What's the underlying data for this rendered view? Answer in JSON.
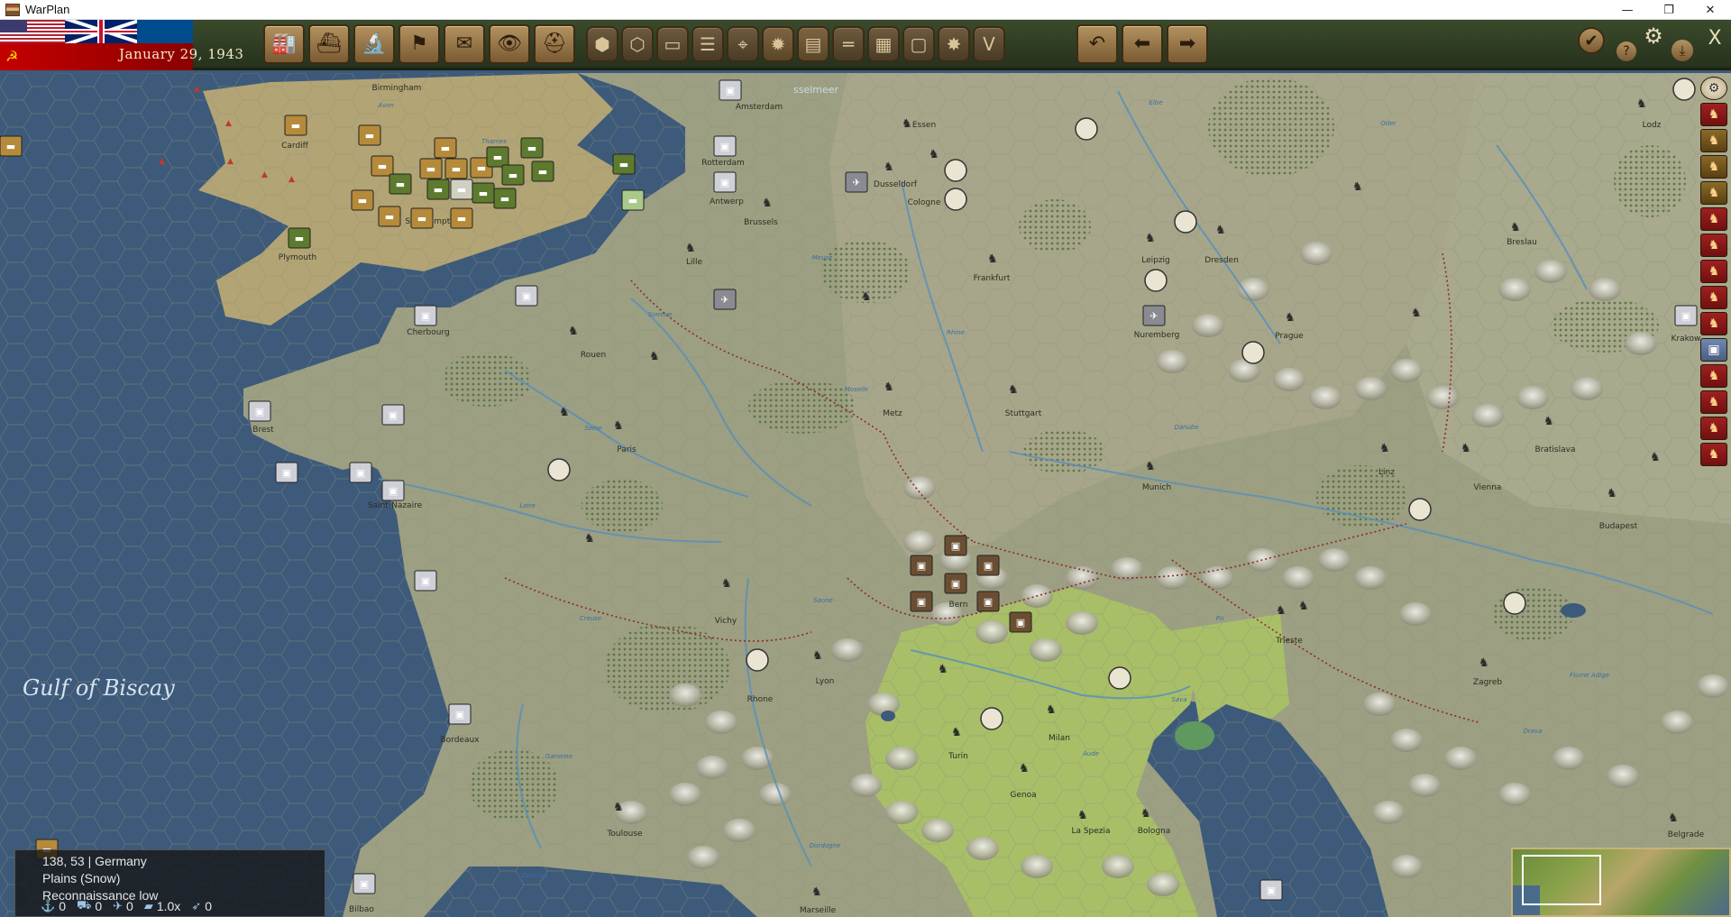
{
  "window": {
    "title": "WarPlan",
    "minimize": "—",
    "restore": "❐",
    "close": "✕"
  },
  "header": {
    "date": "January 29, 1943"
  },
  "toolbar": {
    "left_buttons": [
      {
        "name": "production-button",
        "icon": "factory-icon",
        "glyph": "🏭"
      },
      {
        "name": "naval-button",
        "icon": "ship-icon",
        "glyph": "⛴"
      },
      {
        "name": "research-button",
        "icon": "microscope-icon",
        "glyph": "🔬"
      },
      {
        "name": "diplomacy-button",
        "icon": "flag-icon",
        "glyph": "⚑"
      },
      {
        "name": "reports-button",
        "icon": "report-icon",
        "glyph": "✉"
      },
      {
        "name": "recon-button",
        "icon": "binoculars-icon",
        "glyph": "👁"
      },
      {
        "name": "units-button",
        "icon": "helmet-icon",
        "glyph": "⛑"
      }
    ],
    "map_filter_buttons": [
      {
        "name": "hex-mode-button",
        "icon": "hexagon-icon",
        "glyph": "⬢"
      },
      {
        "name": "hex-grid-button",
        "icon": "hex-grid-icon",
        "glyph": "⬡"
      },
      {
        "name": "supply-view-button",
        "icon": "supply-icon",
        "glyph": "▭"
      },
      {
        "name": "resources-view-button",
        "icon": "stack-icon",
        "glyph": "☰"
      },
      {
        "name": "target-view-button",
        "icon": "crosshair-icon",
        "glyph": "⌖"
      },
      {
        "name": "explosion-view-button",
        "icon": "burst-icon",
        "glyph": "✹"
      },
      {
        "name": "terrain-view-button",
        "icon": "terrain-icon",
        "glyph": "▤"
      },
      {
        "name": "rail-view-button",
        "icon": "rail-icon",
        "glyph": "═"
      },
      {
        "name": "grid-view-button",
        "icon": "grid-icon",
        "glyph": "▦"
      },
      {
        "name": "border-view-button",
        "icon": "frame-icon",
        "glyph": "▢"
      },
      {
        "name": "combat-view-button",
        "icon": "explosion-icon",
        "glyph": "✸"
      },
      {
        "name": "victory-view-button",
        "icon": "v-icon",
        "glyph": "V"
      }
    ],
    "nav_buttons": [
      {
        "name": "undo-button",
        "icon": "undo-icon",
        "glyph": "↶"
      },
      {
        "name": "previous-unit-button",
        "icon": "arrow-left-icon",
        "glyph": "⬅"
      },
      {
        "name": "next-unit-button",
        "icon": "arrow-right-icon",
        "glyph": "➡"
      }
    ],
    "right_buttons": [
      {
        "name": "end-turn-button",
        "icon": "checkmark-icon",
        "glyph": "✔"
      },
      {
        "name": "help-button",
        "icon": "question-icon",
        "glyph": "?"
      },
      {
        "name": "settings-button",
        "icon": "gears-icon",
        "glyph": "⚙"
      },
      {
        "name": "save-button",
        "icon": "download-icon",
        "glyph": "⤓"
      },
      {
        "name": "exit-button",
        "icon": "close-x-icon",
        "glyph": "X"
      }
    ]
  },
  "map": {
    "sea_labels": [
      {
        "name": "gulf-of-biscay",
        "text": "Gulf of Biscay"
      },
      {
        "name": "ijsselmeer",
        "text": "sselmeer"
      }
    ],
    "cities": [
      "Birmingham",
      "Cardiff",
      "Southampton",
      "Plymouth",
      "Amsterdam",
      "Rotterdam",
      "Antwerp",
      "Brussels",
      "Lille",
      "Essen",
      "Dusseldorf",
      "Cologne",
      "Frankfurt",
      "Leipzig",
      "Dresden",
      "Breslau",
      "Lodz",
      "Krakow",
      "Nuremberg",
      "Prague",
      "Cherbourg",
      "Rouen",
      "Paris",
      "Brest",
      "Saint-Nazaire",
      "Metz",
      "Stuttgart",
      "Munich",
      "Linz",
      "Vienna",
      "Bratislava",
      "Budapest",
      "Bern",
      "Vichy",
      "Lyon",
      "Rhone",
      "Turin",
      "Milan",
      "Genoa",
      "La Spezia",
      "Bologna",
      "Trieste",
      "Zagreb",
      "Belgrade",
      "Bordeaux",
      "Toulouse",
      "Marseille",
      "Bilbao"
    ],
    "rivers": [
      "Avon",
      "Thames",
      "Meuse",
      "Somme",
      "Seine",
      "Loire",
      "Moselle",
      "Rhine",
      "Elbe",
      "Oder",
      "Danube",
      "Saone",
      "Creuse",
      "Garonne",
      "Dordogne",
      "Durance",
      "Aude",
      "Po",
      "Fiume Adige",
      "Drava",
      "Sava",
      "Venice"
    ]
  },
  "info_panel": {
    "location": "138, 53 | Germany",
    "terrain": "Plains (Snow)",
    "recon": "Reconnaissance low",
    "stats": [
      {
        "icon": "anchor-icon",
        "value": "0"
      },
      {
        "icon": "supply-truck-icon",
        "value": "0"
      },
      {
        "icon": "aircraft-icon",
        "value": "0"
      },
      {
        "icon": "fortification-icon",
        "value": "1.0x"
      },
      {
        "icon": "plane-icon",
        "value": "0"
      }
    ]
  },
  "colors": {
    "sea": "#3d5a7a",
    "land_france": "#9c9f82",
    "land_germany": "#a7a68a",
    "land_britain": "#b2a474",
    "land_italy": "#a8bf68",
    "toolbar": "#2f3c25",
    "axis_unit": "#6b4e32",
    "allied_unit_green": "#5d7a2e",
    "allied_unit_gold": "#b58a3a"
  }
}
